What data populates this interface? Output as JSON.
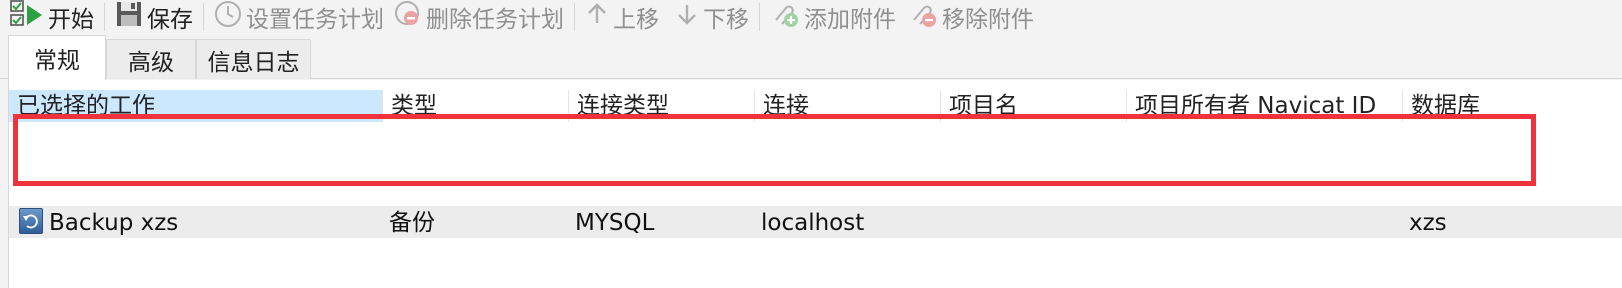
{
  "toolbar": {
    "start_label": "开始",
    "save_label": "保存",
    "set_schedule_label": "设置任务计划",
    "delete_schedule_label": "删除任务计划",
    "move_up_label": "上移",
    "move_down_label": "下移",
    "add_attachment_label": "添加附件",
    "remove_attachment_label": "移除附件"
  },
  "tabs": [
    {
      "label": "常规",
      "active": true
    },
    {
      "label": "高级",
      "active": false
    },
    {
      "label": "信息日志",
      "active": false
    }
  ],
  "grid": {
    "columns": [
      "已选择的工作",
      "类型",
      "连接类型",
      "连接",
      "项目名",
      "项目所有者 Navicat ID",
      "数据库"
    ],
    "rows": [
      {
        "job": "Backup xzs",
        "type": "备份",
        "connection_type": "MYSQL",
        "connection": "localhost",
        "project": "",
        "owner": "",
        "database": "xzs"
      }
    ]
  },
  "colors": {
    "highlight": "#f0323c",
    "selected_header": "#cce8ff",
    "row_bg": "#ececec",
    "accent_green": "#2ea043"
  }
}
